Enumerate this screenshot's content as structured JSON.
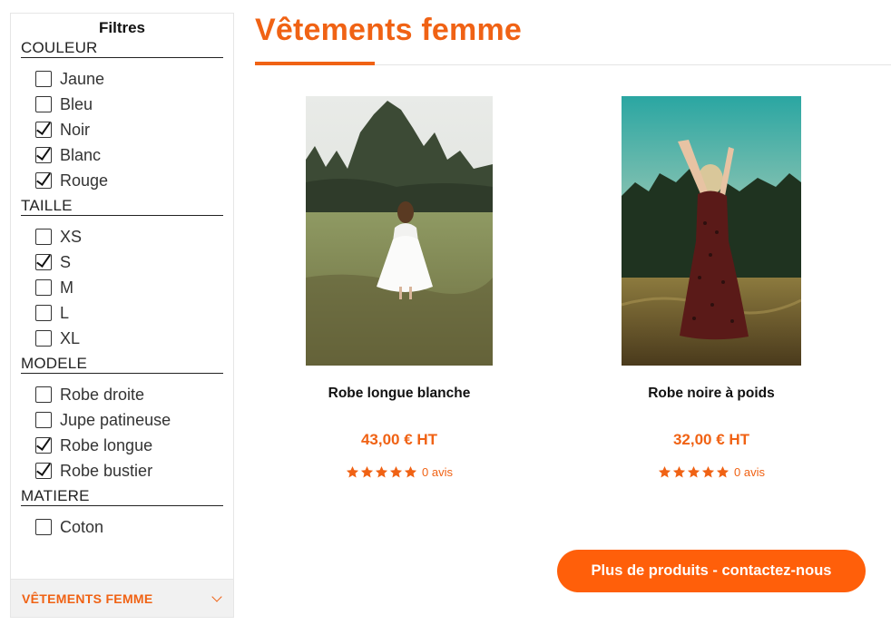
{
  "sidebar": {
    "title": "Filtres",
    "groups": [
      {
        "title": "COULEUR",
        "options": [
          {
            "label": "Jaune",
            "checked": false
          },
          {
            "label": "Bleu",
            "checked": false
          },
          {
            "label": "Noir",
            "checked": true
          },
          {
            "label": "Blanc",
            "checked": true
          },
          {
            "label": "Rouge",
            "checked": true
          }
        ]
      },
      {
        "title": "TAILLE",
        "options": [
          {
            "label": "XS",
            "checked": false
          },
          {
            "label": "S",
            "checked": true
          },
          {
            "label": "M",
            "checked": false
          },
          {
            "label": "L",
            "checked": false
          },
          {
            "label": "XL",
            "checked": false
          }
        ]
      },
      {
        "title": "MODELE",
        "options": [
          {
            "label": "Robe droite",
            "checked": false
          },
          {
            "label": "Jupe patineuse",
            "checked": false
          },
          {
            "label": "Robe longue",
            "checked": true
          },
          {
            "label": "Robe bustier",
            "checked": true
          }
        ]
      },
      {
        "title": "MATIERE",
        "options": [
          {
            "label": "Coton",
            "checked": false
          }
        ]
      }
    ],
    "footer_label": "VÊTEMENTS FEMME",
    "footer_icon": "chevron-down-icon"
  },
  "main": {
    "title": "Vêtements femme",
    "products": [
      {
        "name": "Robe longue blanche",
        "price": "43,00 € HT",
        "rating": 5,
        "reviews": "0 avis"
      },
      {
        "name": "Robe noire à poids",
        "price": "32,00 € HT",
        "rating": 5,
        "reviews": "0 avis"
      }
    ],
    "cta_label": "Plus de produits - contactez-nous"
  },
  "colors": {
    "accent": "#f06214",
    "button": "#ff5f0a"
  }
}
